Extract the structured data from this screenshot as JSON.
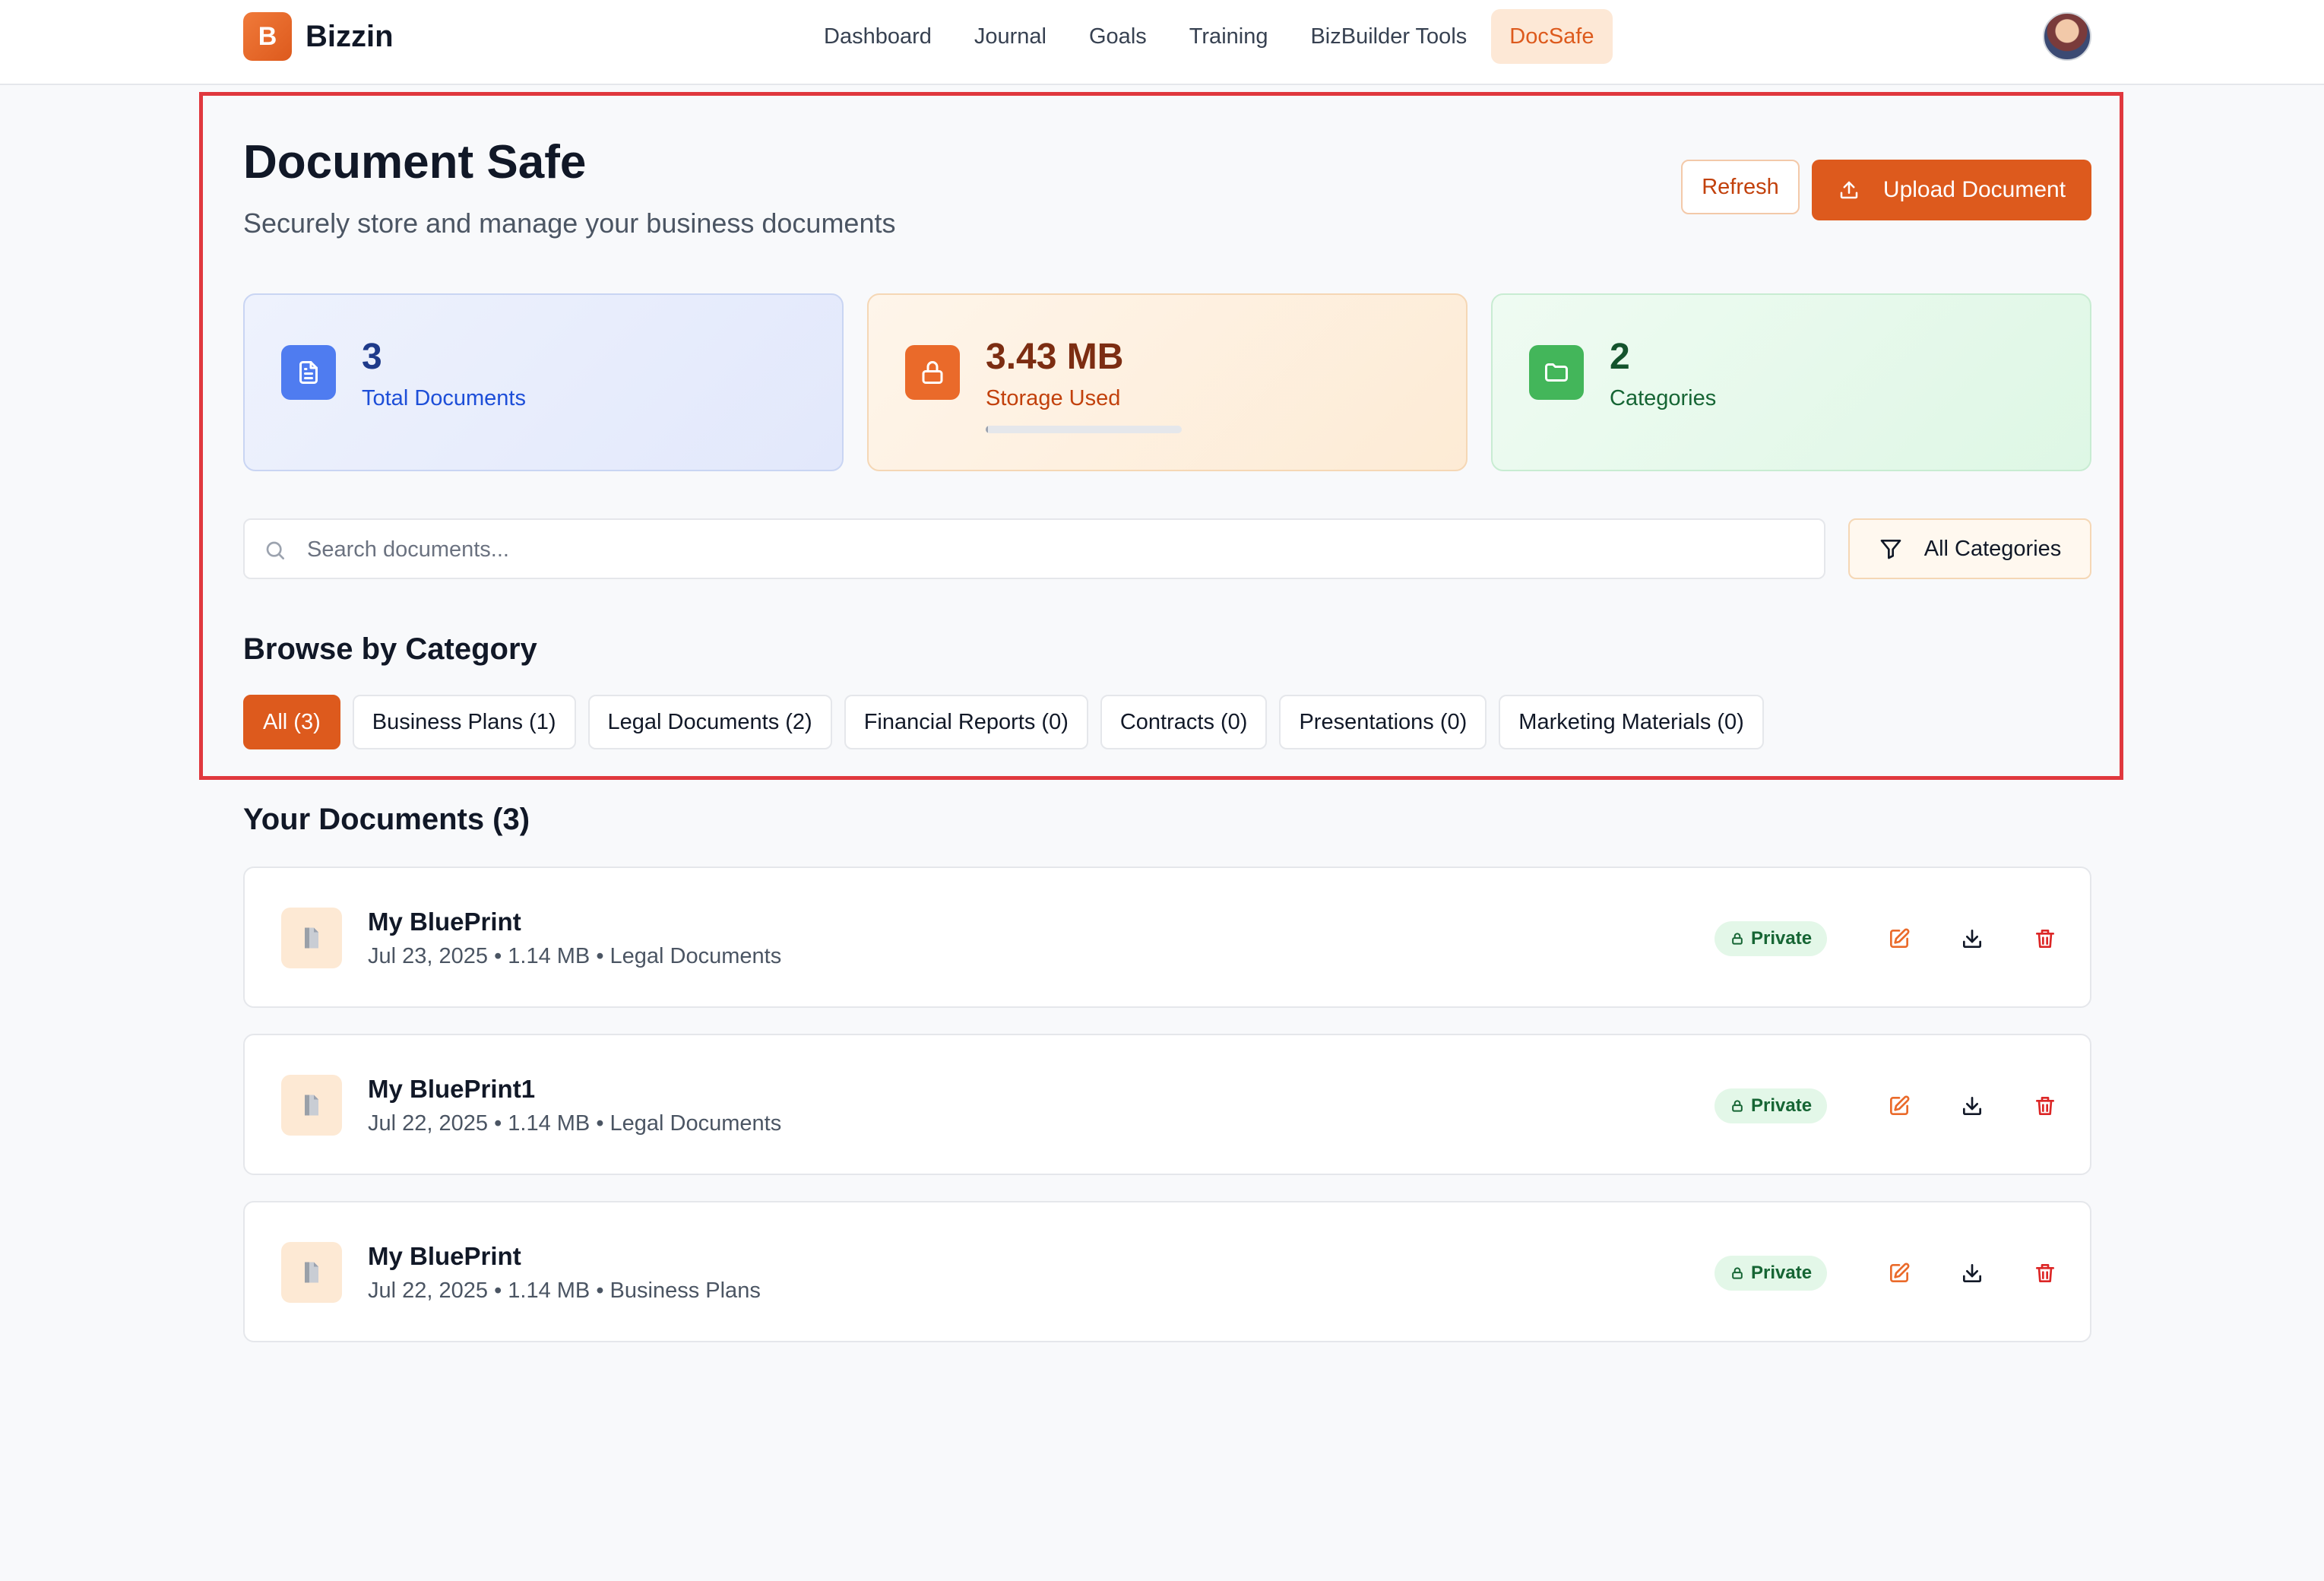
{
  "brand": {
    "logo_letter": "B",
    "name": "Bizzin"
  },
  "nav": {
    "items": [
      {
        "label": "Dashboard",
        "active": false
      },
      {
        "label": "Journal",
        "active": false
      },
      {
        "label": "Goals",
        "active": false
      },
      {
        "label": "Training",
        "active": false
      },
      {
        "label": "BizBuilder Tools",
        "active": false
      },
      {
        "label": "DocSafe",
        "active": true
      }
    ]
  },
  "header": {
    "title": "Document Safe",
    "subtitle": "Securely store and manage your business documents",
    "refresh_label": "Refresh",
    "upload_label": "Upload Document"
  },
  "stats": {
    "total_documents": {
      "value": "3",
      "label": "Total Documents",
      "icon": "file-text-icon"
    },
    "storage": {
      "value": "3.43 MB",
      "label": "Storage Used",
      "icon": "lock-icon",
      "usage_fraction": 0.01
    },
    "categories": {
      "value": "2",
      "label": "Categories",
      "icon": "folder-icon"
    }
  },
  "search": {
    "placeholder": "Search documents...",
    "value": ""
  },
  "filter": {
    "label": "All Categories"
  },
  "browse": {
    "title": "Browse by Category",
    "chips": [
      {
        "label": "All (3)",
        "active": true
      },
      {
        "label": "Business Plans (1)",
        "active": false
      },
      {
        "label": "Legal Documents (2)",
        "active": false
      },
      {
        "label": "Financial Reports (0)",
        "active": false
      },
      {
        "label": "Contracts (0)",
        "active": false
      },
      {
        "label": "Presentations (0)",
        "active": false
      },
      {
        "label": "Marketing Materials (0)",
        "active": false
      }
    ]
  },
  "documents": {
    "title": "Your Documents (3)",
    "items": [
      {
        "name": "My BluePrint",
        "meta": "Jul 23, 2025 • 1.14 MB • Legal Documents",
        "badge": "Private"
      },
      {
        "name": "My BluePrint1",
        "meta": "Jul 22, 2025 • 1.14 MB • Legal Documents",
        "badge": "Private"
      },
      {
        "name": "My BluePrint",
        "meta": "Jul 22, 2025 • 1.14 MB • Business Plans",
        "badge": "Private"
      }
    ]
  },
  "colors": {
    "accent": "#dd5a1d",
    "highlight_frame": "#e0383e",
    "private_badge_bg": "#e3f7e8",
    "delete_icon": "#dc2626"
  }
}
